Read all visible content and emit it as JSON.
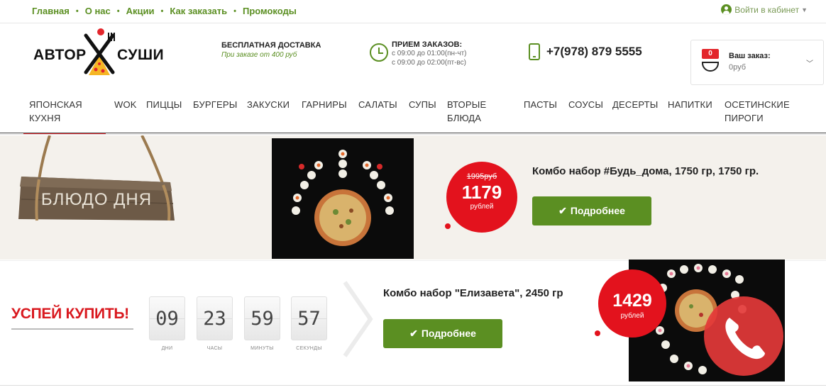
{
  "topnav": {
    "items": [
      "Главная",
      "О нас",
      "Акции",
      "Как заказать",
      "Промокоды"
    ],
    "separator": "•"
  },
  "login": {
    "label": "Войти в кабинет"
  },
  "logo": {
    "left": "АВТОР",
    "right": "СУШИ"
  },
  "delivery": {
    "title": "БЕСПЛАТНАЯ ДОСТАВКА",
    "subtitle": "При заказе от 400 руб"
  },
  "hours": {
    "title": "ПРИЕМ ЗАКАЗОВ:",
    "line1": "с 09:00 до 01:00(пн-чт)",
    "line2": "с 09:00 до 02:00(пт-вс)"
  },
  "phone": {
    "number": "+7(978) 879 5555"
  },
  "cart": {
    "count": "0",
    "label": "Ваш заказ:",
    "total": "0руб"
  },
  "categories": [
    {
      "l1": "ЯПОНСКАЯ",
      "l2": "КУХНЯ"
    },
    {
      "l1": "WOK",
      "l2": ""
    },
    {
      "l1": "ПИЦЦЫ",
      "l2": ""
    },
    {
      "l1": "БУРГЕРЫ",
      "l2": ""
    },
    {
      "l1": "ЗАКУСКИ",
      "l2": ""
    },
    {
      "l1": "ГАРНИРЫ",
      "l2": ""
    },
    {
      "l1": "САЛАТЫ",
      "l2": ""
    },
    {
      "l1": "СУПЫ",
      "l2": ""
    },
    {
      "l1": "ВТОРЫЕ",
      "l2": "БЛЮДА"
    },
    {
      "l1": "ПАСТЫ",
      "l2": ""
    },
    {
      "l1": "СОУСЫ",
      "l2": ""
    },
    {
      "l1": "ДЕСЕРТЫ",
      "l2": ""
    },
    {
      "l1": "НАПИТКИ",
      "l2": ""
    },
    {
      "l1": "ОСЕТИНСКИЕ",
      "l2": "ПИРОГИ"
    }
  ],
  "dish_of_day": {
    "sign_text": "БЛЮДО ДНЯ",
    "old_price": "1995руб",
    "price": "1179",
    "unit": "рублей",
    "title": "Комбо набор #Будь_дома, 1750 гр, 1750 гр.",
    "button": "Подробнее"
  },
  "hurry": {
    "heading": "УСПЕЙ КУПИТЬ!",
    "timer": [
      {
        "value": "09",
        "label": "ДНИ"
      },
      {
        "value": "23",
        "label": "ЧАСЫ"
      },
      {
        "value": "59",
        "label": "МИНУТЫ"
      },
      {
        "value": "57",
        "label": "СЕКУНДЫ"
      }
    ],
    "title": "Комбо набор \"Елизавета\", 2450 гр",
    "button": "Подробнее",
    "price": "1429",
    "unit": "рублей"
  },
  "icons": {
    "user": "user-circle-icon",
    "caret": "caret-down-icon",
    "clock": "clock-icon",
    "phone": "mobile-phone-icon",
    "bowl": "bowl-icon",
    "check": "check-icon",
    "call": "phone-call-icon"
  },
  "colors": {
    "brand_green": "#5b8f22",
    "accent_red": "#e3121d"
  }
}
